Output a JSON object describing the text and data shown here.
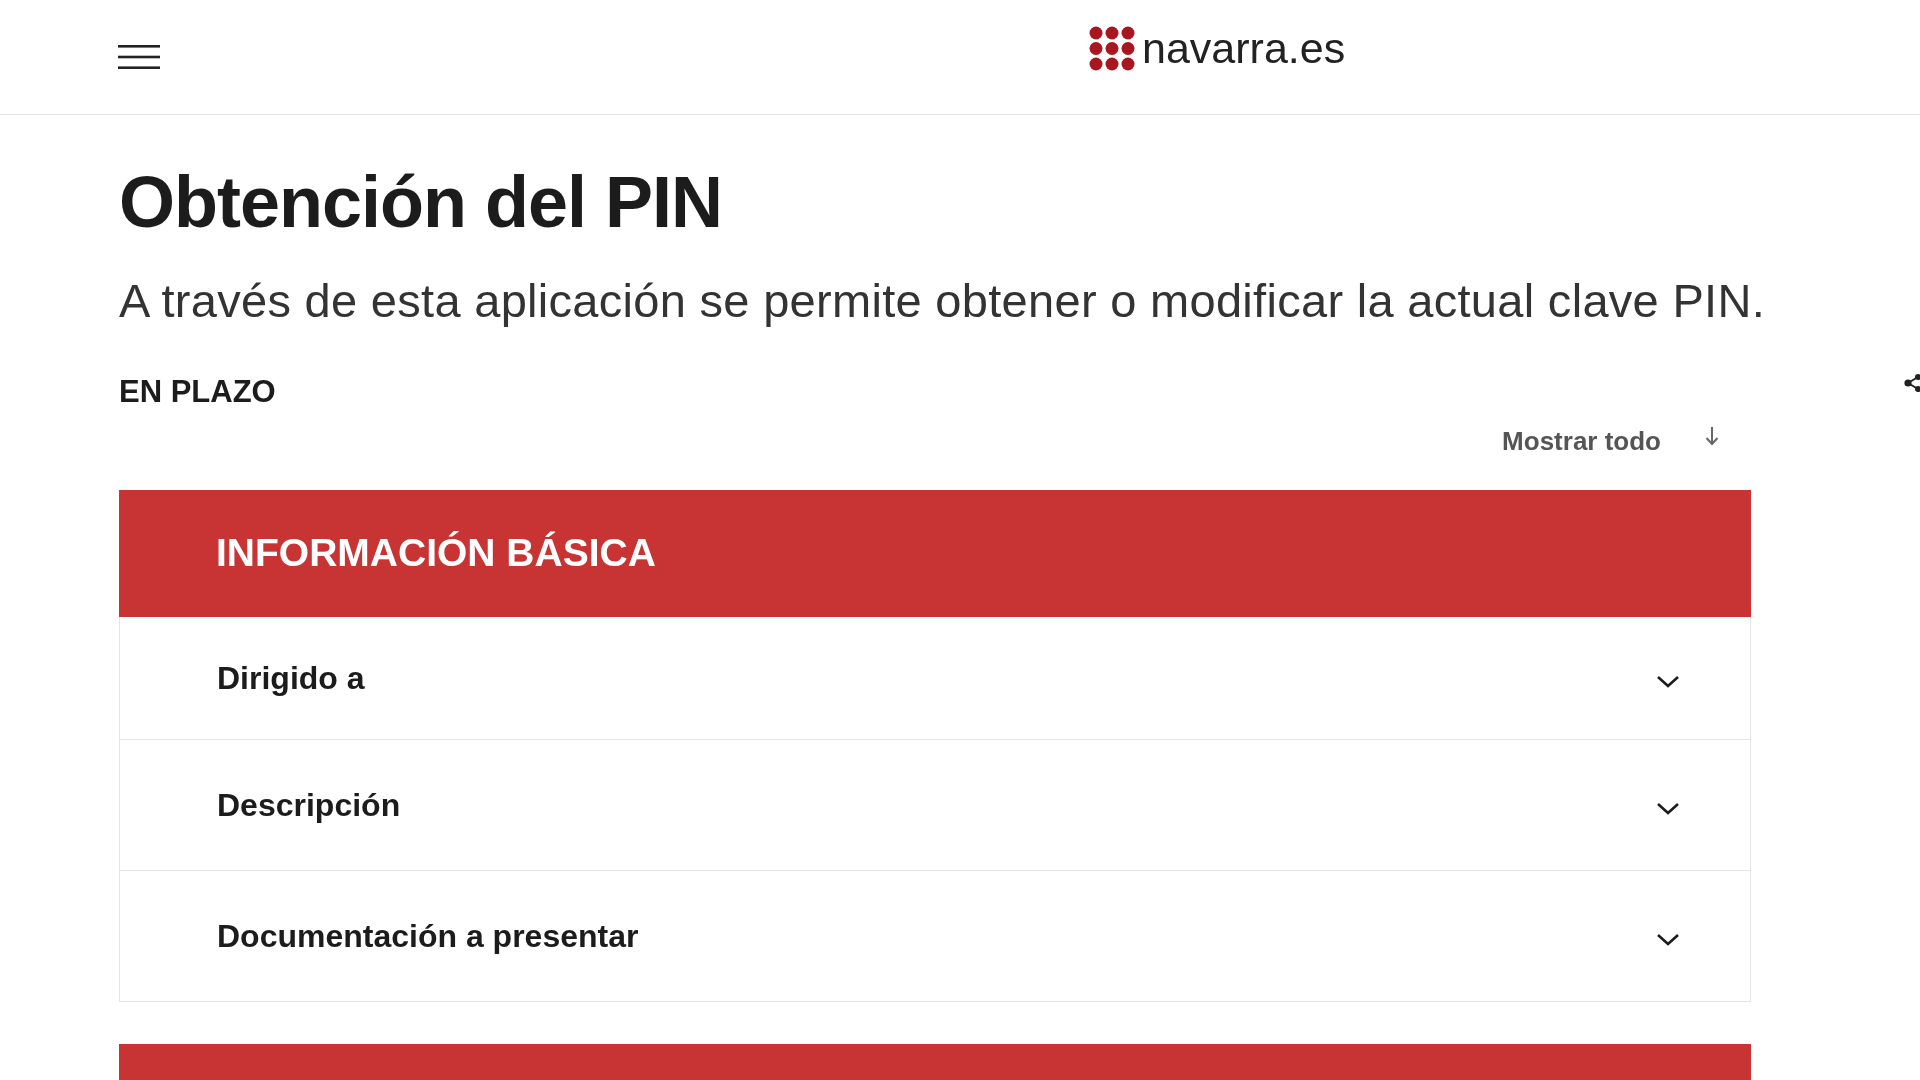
{
  "header": {
    "logo_text": "navarra.es"
  },
  "page": {
    "title": "Obtención del PIN",
    "subtitle": "A través de esta aplicación se permite obtener o modificar la actual clave PIN.",
    "status": "EN PLAZO",
    "show_all": "Mostrar todo"
  },
  "sections": [
    {
      "kind": "accordion",
      "title": "INFORMACIÓN BÁSICA",
      "items": [
        {
          "label": "Dirigido a",
          "expanded": false
        },
        {
          "label": "Descripción",
          "expanded": false
        },
        {
          "label": "Documentación a presentar",
          "expanded": false
        }
      ]
    },
    {
      "kind": "header"
    }
  ]
}
